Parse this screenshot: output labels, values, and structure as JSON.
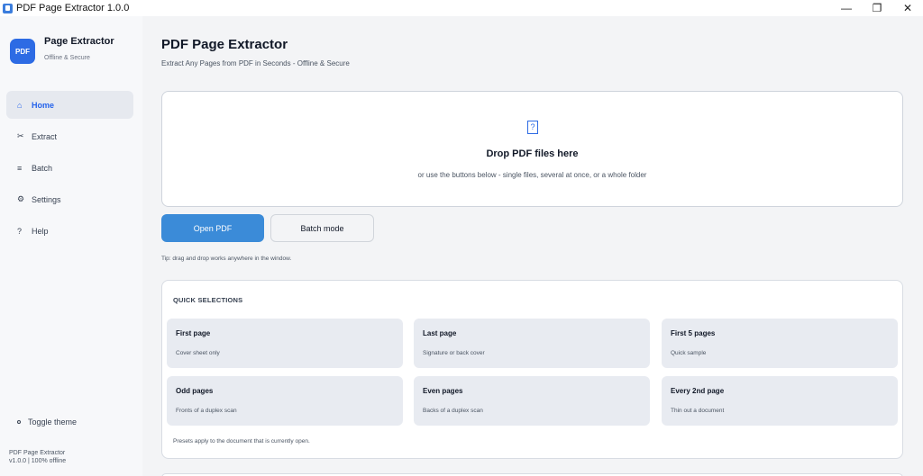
{
  "window": {
    "title": "PDF Page Extractor 1.0.0",
    "controls": {
      "minimize": "—",
      "maximize": "❐",
      "close": "✕"
    }
  },
  "brand": {
    "logo": "PDF",
    "title": "Page Extractor",
    "subtitle": "Offline & Secure"
  },
  "sidebar": {
    "items": [
      {
        "label": "Home",
        "icon": "⌂",
        "icon_name": "home-icon",
        "active": true
      },
      {
        "label": "Extract",
        "icon": "✂",
        "icon_name": "scissors-icon"
      },
      {
        "label": "Batch",
        "icon": "≡",
        "icon_name": "list-icon"
      },
      {
        "label": "Settings",
        "icon": "⚙",
        "icon_name": "gear-icon"
      },
      {
        "label": "Help",
        "icon": "?",
        "icon_name": "help-icon"
      }
    ],
    "toggle_theme": "Toggle theme",
    "version_line1": "PDF Page Extractor",
    "version_line2": "v1.0.0 | 100% offline"
  },
  "main": {
    "title": "PDF Page Extractor",
    "subtitle": "Extract Any Pages from PDF in Seconds - Offline & Secure",
    "dropzone": {
      "icon": "?",
      "title": "Drop PDF files here",
      "subtitle": "or use the buttons below - single files, several at once, or a whole folder"
    },
    "open_pdf": "Open PDF",
    "batch_mode": "Batch mode",
    "tip": "Tip: drag and drop works anywhere in the window.",
    "quick": {
      "header": "QUICK SELECTIONS",
      "tiles": [
        {
          "title": "First page",
          "desc": "Cover sheet only"
        },
        {
          "title": "Last page",
          "desc": "Signature or back cover"
        },
        {
          "title": "First 5 pages",
          "desc": "Quick sample"
        },
        {
          "title": "Odd pages",
          "desc": "Fronts of a duplex scan"
        },
        {
          "title": "Even pages",
          "desc": "Backs of a duplex scan"
        },
        {
          "title": "Every 2nd page",
          "desc": "Thin out a document"
        }
      ],
      "footer": "Presets apply to the document that is currently open."
    }
  },
  "colors": {
    "accent": "#2d6be4",
    "primary_button": "#3b8bd8",
    "active_nav": "#e6e9ef"
  }
}
